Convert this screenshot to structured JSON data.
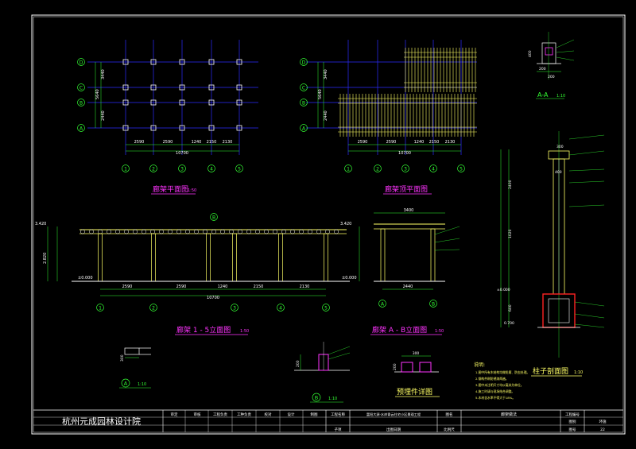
{
  "colors": {
    "background": "#000000",
    "border": "#ffffff",
    "grid": "#2c2cff",
    "dimension": "#ffffff",
    "structure": "#ffff66",
    "green": "#33ff33",
    "magenta": "#ff33ff",
    "red": "#ff2222",
    "cyan": "#33ffff"
  },
  "views": {
    "plan": {
      "title": "廊架平面图",
      "scale": "1:50"
    },
    "roof": {
      "title": "廊架顶平面图"
    },
    "elev15": {
      "title": "廊架 1 - 5立面图",
      "scale": "1:50"
    },
    "elevAB": {
      "title": "廊架 A - B立面图",
      "scale": "1:50"
    },
    "section_aa": {
      "title": "A-A",
      "scale": "1:10"
    },
    "column": {
      "title": "柱子剖面图",
      "scale": "1:10"
    },
    "detail_a": {
      "label": "A",
      "scale": "1:10"
    },
    "detail_b": {
      "label": "B",
      "scale": "1:10"
    },
    "embed": {
      "title": "预埋件详图"
    }
  },
  "dims": {
    "bays": [
      "2590",
      "2590",
      "1240",
      "2150",
      "2130"
    ],
    "overall": "10700",
    "col_span": "2440",
    "plan_row_dims": [
      "3440",
      "5640",
      "2440"
    ],
    "elev_heights": [
      "3.420",
      "±0.000",
      "2.820"
    ],
    "ab_dims": [
      "3400",
      "2440"
    ],
    "column_dims": [
      "400",
      "2400",
      "1020",
      "600",
      "300",
      "0.700"
    ],
    "section_dims": [
      "200",
      "400",
      "200"
    ],
    "embed_dims": [
      "300",
      "200",
      "100"
    ],
    "detail_a_dims": [
      "300",
      "100"
    ],
    "detail_b_dims": [
      "200",
      "100"
    ]
  },
  "axes": {
    "numbers": [
      "1",
      "2",
      "3",
      "4",
      "5"
    ],
    "letters": [
      "D",
      "C",
      "B",
      "A"
    ]
  },
  "notes": {
    "title": "说明:",
    "lines": [
      "1.图中所有木结构均做防腐、防虫处理。",
      "2.钢构件刷防锈漆两遍。",
      "3.图中未注明尺寸均以毫米为单位。",
      "4.施工时请与现场结合调整。",
      "5.木材含水率不得大于18%。"
    ]
  },
  "title_block": {
    "company": "杭州元成园林设计院",
    "roles": [
      "审定",
      "审核",
      "工程负责",
      "工种负责",
      "校对",
      "设计",
      "制图"
    ],
    "project_label": "工程名称",
    "project_name": "富阳大源·水岸青云住宅小区景观工程",
    "sub_label": "子项",
    "date_label": "出图日期",
    "drawing_label": "图名",
    "drawing_name": "廊架做法",
    "scale_label": "比例尺",
    "project_no_label": "工程编号",
    "stage_label": "图别",
    "stage_value": "环施",
    "sheet_label": "图号",
    "sheet_value": "22"
  }
}
